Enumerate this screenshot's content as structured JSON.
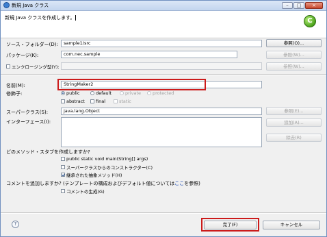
{
  "window": {
    "title": "新規 Java クラス",
    "controls": {
      "minimize": "–",
      "maximize": "□",
      "close": "×"
    }
  },
  "header": {
    "message": "新規 Java クラスを作成します。",
    "logo_letter": "C"
  },
  "form": {
    "source_folder": {
      "label": "ソース・フォルダー(D):",
      "value": "sample1/src",
      "browse": "参照(O)..."
    },
    "package": {
      "label": "パッケージ(K):",
      "value": "com.nec.sample",
      "browse": "参照(W)..."
    },
    "enclosing": {
      "label": "エンクロージング型(Y):",
      "checked": false,
      "browse": "参照(W)..."
    },
    "name": {
      "label": "名前(M):",
      "value": "StringMaker2"
    },
    "modifiers": {
      "label": "修飾子:",
      "radios": [
        {
          "label": "public",
          "checked": true,
          "enabled": true
        },
        {
          "label": "default",
          "checked": false,
          "enabled": true
        },
        {
          "label": "private",
          "checked": false,
          "enabled": false
        },
        {
          "label": "protected",
          "checked": false,
          "enabled": false
        }
      ],
      "checkboxes": [
        {
          "label": "abstract",
          "checked": false,
          "enabled": true
        },
        {
          "label": "final",
          "checked": false,
          "enabled": true
        },
        {
          "label": "static",
          "checked": false,
          "enabled": false
        }
      ]
    },
    "superclass": {
      "label": "スーパークラス(S):",
      "value": "java.lang.Object",
      "browse": "参照(E)..."
    },
    "interfaces": {
      "label": "インターフェース(I):",
      "add": "追加(A)...",
      "remove": "除去(R)"
    },
    "stubs": {
      "question": "どのメソッド・スタブを作成しますか?",
      "options": [
        {
          "label": "public static void main(String[] args)",
          "checked": false
        },
        {
          "label": "スーパークラスからのコンストラクター(C)",
          "checked": false
        },
        {
          "label": "継承された抽象メソッド(H)",
          "checked": true
        }
      ]
    },
    "comments": {
      "question_prefix": "コメントを追加しますか? (テンプレートの構成およびデフォルト値については",
      "link": "ここ",
      "question_suffix": "を参照)",
      "option": {
        "label": "コメントの生成(G)",
        "checked": false
      }
    }
  },
  "footer": {
    "help": "?",
    "finish": "完了(F)",
    "cancel": "キャンセル"
  },
  "colors": {
    "highlight": "#cc1b1b",
    "link": "#0b3fb3"
  }
}
